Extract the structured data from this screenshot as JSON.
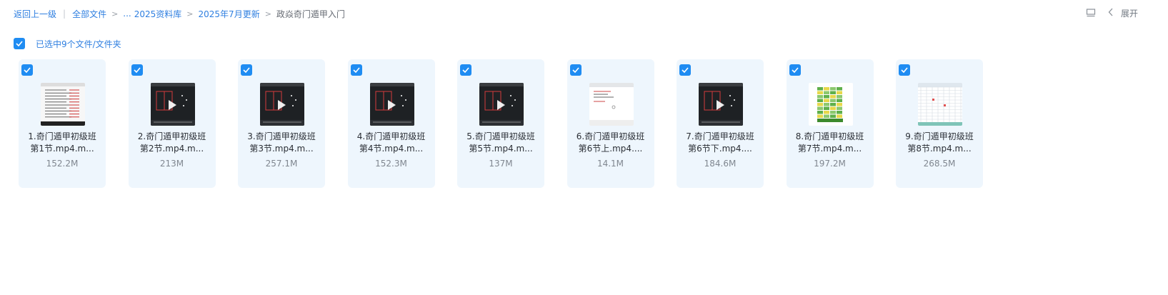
{
  "breadcrumb": {
    "back": "返回上一级",
    "all_files": "全部文件",
    "ellipsis": "...",
    "crumb1": "2025资料库",
    "crumb2": "2025年7月更新",
    "current": "政焱奇门遁甲入门",
    "sep": ">",
    "pipe": "|"
  },
  "header": {
    "expand_label": "展开",
    "list_icon": "list-view-icon",
    "chevron_icon": "chevron-left-icon"
  },
  "selection": {
    "text": "已选中9个文件/文件夹",
    "checked": true
  },
  "colors": {
    "accent": "#1f8cf2",
    "link": "#2f7fe0",
    "card_bg": "#eef6fd"
  },
  "files": [
    {
      "line1": "1.奇门遁甲初级班",
      "line2": "第1节.mp4.m...",
      "size": "152.2M",
      "thumb": "document"
    },
    {
      "line1": "2.奇门遁甲初级班",
      "line2": "第2节.mp4.m...",
      "size": "213M",
      "thumb": "video-dark"
    },
    {
      "line1": "3.奇门遁甲初级班",
      "line2": "第3节.mp4.m...",
      "size": "257.1M",
      "thumb": "video-dark"
    },
    {
      "line1": "4.奇门遁甲初级班",
      "line2": "第4节.mp4.m...",
      "size": "152.3M",
      "thumb": "video-dark"
    },
    {
      "line1": "5.奇门遁甲初级班",
      "line2": "第5节.mp4.m...",
      "size": "137M",
      "thumb": "video-dark"
    },
    {
      "line1": "6.奇门遁甲初级班",
      "line2": "第6节上.mp4....",
      "size": "14.1M",
      "thumb": "video-light"
    },
    {
      "line1": "7.奇门遁甲初级班",
      "line2": "第6节下.mp4....",
      "size": "184.6M",
      "thumb": "video-dark"
    },
    {
      "line1": "8.奇门遁甲初级班",
      "line2": "第7节.mp4.m...",
      "size": "197.2M",
      "thumb": "chart-green"
    },
    {
      "line1": "9.奇门遁甲初级班",
      "line2": "第8节.mp4.m...",
      "size": "268.5M",
      "thumb": "spreadsheet"
    }
  ]
}
